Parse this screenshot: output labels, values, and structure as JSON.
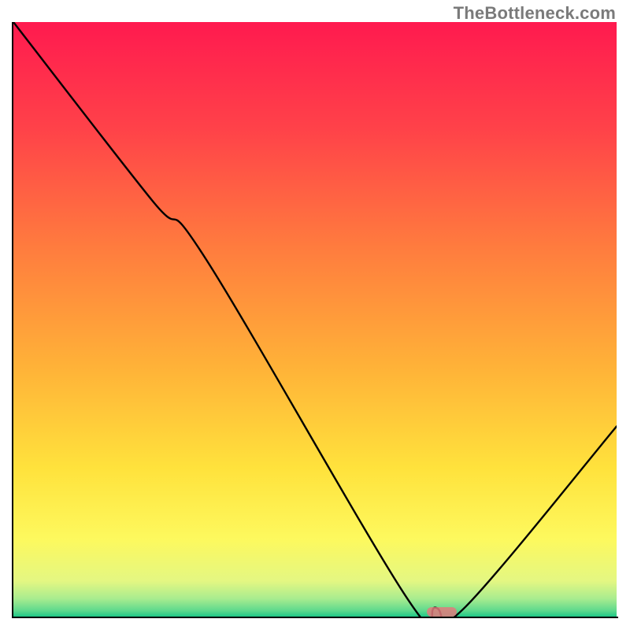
{
  "watermark": "TheBottleneck.com",
  "chart_data": {
    "type": "line",
    "title": "",
    "xlabel": "",
    "ylabel": "",
    "xlim": [
      0,
      100
    ],
    "ylim": [
      0,
      100
    ],
    "grid": false,
    "legend": false,
    "series": [
      {
        "name": "curve",
        "x": [
          0,
          23,
          32,
          65,
          70,
          75,
          100
        ],
        "values": [
          100,
          70,
          60,
          3.5,
          1.5,
          1.7,
          32
        ]
      }
    ],
    "marker": {
      "x": 71,
      "y": 0.8
    },
    "gradient_stops": [
      {
        "pct": 0,
        "color": "#ff1a4f"
      },
      {
        "pct": 18,
        "color": "#ff4249"
      },
      {
        "pct": 38,
        "color": "#ff7c3e"
      },
      {
        "pct": 58,
        "color": "#ffb238"
      },
      {
        "pct": 75,
        "color": "#ffe23c"
      },
      {
        "pct": 87,
        "color": "#fdf95e"
      },
      {
        "pct": 94,
        "color": "#e4f782"
      },
      {
        "pct": 97,
        "color": "#a8ec8f"
      },
      {
        "pct": 99,
        "color": "#5ed98d"
      },
      {
        "pct": 100,
        "color": "#1ec787"
      }
    ]
  }
}
